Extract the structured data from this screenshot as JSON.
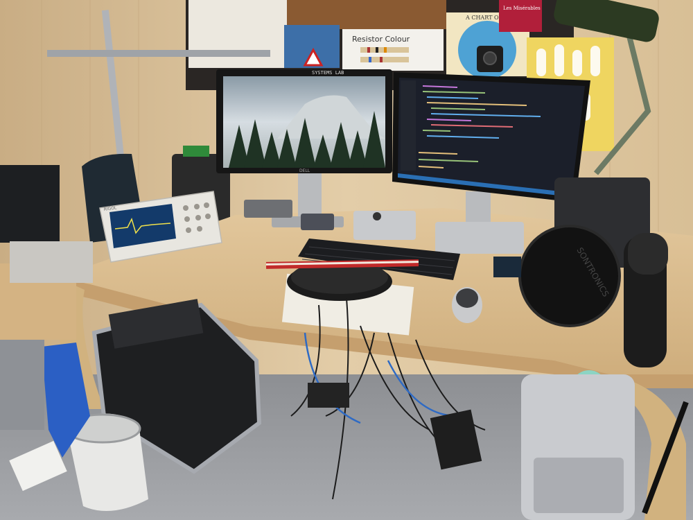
{
  "scene": {
    "monitor_left_brand": "DELL",
    "monitor_top_sticker": "SYSTEMS LAB",
    "poster_resistor_title": "Resistor Colour",
    "poster_chart_title": "A CHART OF THE",
    "poster_red_title": "Les Misérables",
    "pop_filter_brand": "SONTRONICS",
    "oscilloscope_brand": "RIGOL"
  },
  "colors": {
    "wall": "#d9c3a0",
    "desk": "#d8b98a",
    "floor": "#9a9ca0",
    "code_bg": "#1b1f2a",
    "scope_body": "#e8e6e0"
  }
}
